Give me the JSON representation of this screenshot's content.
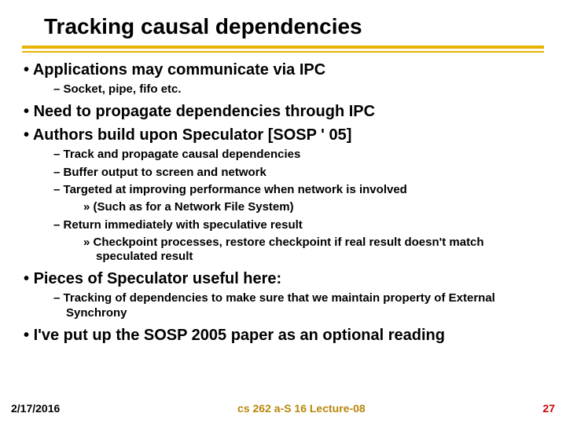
{
  "title": "Tracking causal dependencies",
  "bullets": {
    "b1": "Applications may communicate via IPC",
    "b1_1": "Socket, pipe, fifo etc.",
    "b2": "Need to propagate dependencies through IPC",
    "b3": "Authors build upon Speculator [SOSP ' 05]",
    "b3_1": "Track and propagate causal dependencies",
    "b3_2": "Buffer output to screen and network",
    "b3_3": "Targeted at improving performance when network is involved",
    "b3_3_1": "(Such as for a Network File System)",
    "b3_4": "Return immediately with speculative result",
    "b3_4_1": "Checkpoint processes, restore checkpoint if real result doesn't match speculated result",
    "b4": "Pieces of Speculator useful here:",
    "b4_1": "Tracking of dependencies to make sure that we maintain property of External Synchrony",
    "b5": "I've put up the SOSP 2005 paper as an optional reading"
  },
  "footer": {
    "date": "2/17/2016",
    "course": "cs 262 a-S 16 Lecture-08",
    "page": "27"
  }
}
